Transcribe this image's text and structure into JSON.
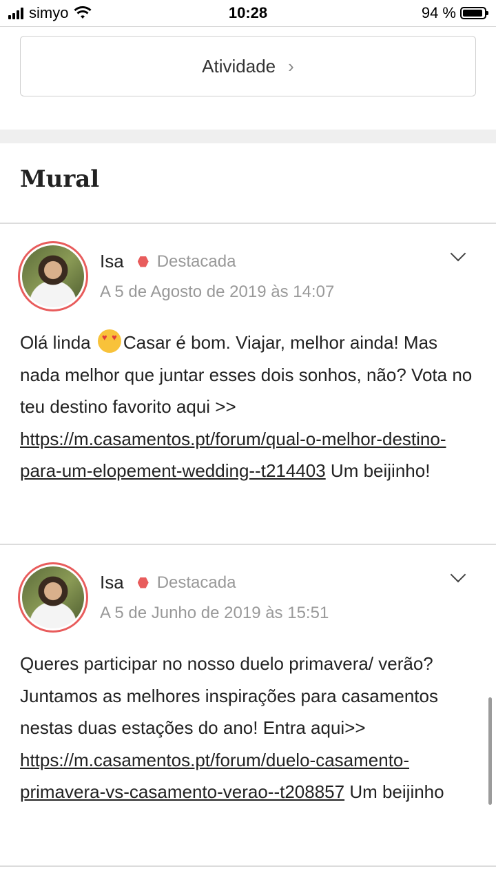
{
  "status_bar": {
    "carrier": "simyo",
    "time": "10:28",
    "battery_percent": "94 %",
    "battery_level": 0.94
  },
  "activity": {
    "label": "Atividade",
    "chevron_icon": "chevron-right-icon"
  },
  "mural": {
    "title": "Mural",
    "posts": [
      {
        "author": "Isa",
        "badge": "Destacada",
        "date": "A 5 de Agosto de 2019 às 14:07",
        "text_1": "Olá linda ",
        "emoji": "heart-eyes-emoji",
        "text_2": "Casar é bom. Viajar, melhor ainda! Mas nada melhor que juntar esses dois sonhos, não? Vota no teu destino favorito aqui >> ",
        "link": "https://m.casamentos.pt/forum/qual-o-melhor-destino-para-um-elopement-wedding--t214403",
        "text_3": " Um beijinho!"
      },
      {
        "author": "Isa",
        "badge": "Destacada",
        "date": "A 5 de Junho de 2019 às 15:51",
        "text_1": "Queres participar no nosso duelo primavera/ verão? Juntamos as melhores inspirações para casamentos nestas duas estações do ano! Entra aqui>> ",
        "link": "https://m.casamentos.pt/forum/duelo-casamento-primavera-vs-casamento-verao--t208857",
        "text_3": " Um beijinho"
      }
    ]
  },
  "colors": {
    "accent": "#e85c5c",
    "muted_text": "#999999",
    "divider": "#dcdcdc"
  }
}
